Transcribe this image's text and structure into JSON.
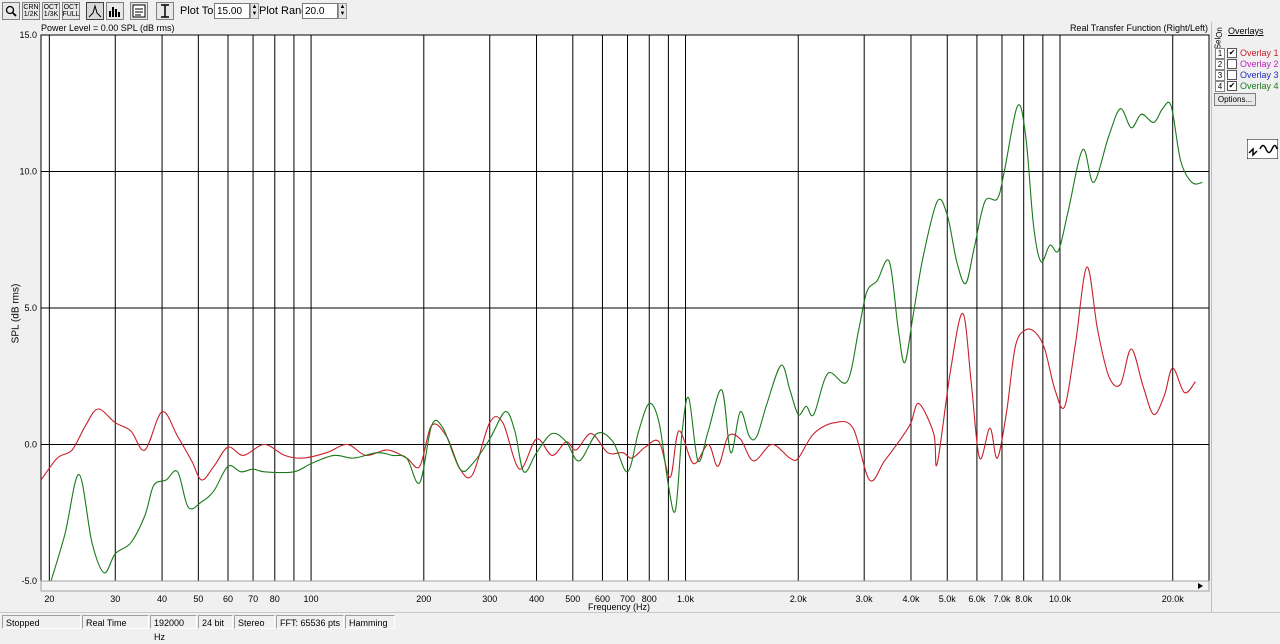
{
  "toolbar": {
    "buttons": [
      {
        "icon": "magnifier-icon"
      },
      {
        "label": "CRN\n1/2K"
      },
      {
        "label": "OCT\n1/3K"
      },
      {
        "label": "OCT\nFULL"
      },
      {
        "icon": "peak-icon"
      },
      {
        "icon": "bars-icon"
      },
      {
        "icon": "window-icon"
      },
      {
        "icon": "cursor-icon"
      }
    ],
    "plot_top_label": "Plot Top:",
    "plot_top_value": "15.00",
    "plot_range_label": "Plot Range:",
    "plot_range_value": "20.0"
  },
  "plot": {
    "power_level": "Power Level = 0.00 SPL (dB rms)",
    "mode": "Real Transfer Function (Right/Left)",
    "ylabel": "SPL (dB rms)",
    "xlabel": "Frequency (Hz)"
  },
  "overlays": {
    "title": "Overlays",
    "col_sel": "Sel",
    "col_on": "On",
    "options_label": "Options...",
    "items": [
      {
        "num": "1",
        "name": "Overlay 1",
        "checked": true,
        "color": "#c8202a"
      },
      {
        "num": "2",
        "name": "Overlay 2",
        "checked": false,
        "color": "#c020c0"
      },
      {
        "num": "3",
        "name": "Overlay 3",
        "checked": false,
        "color": "#2030c0"
      },
      {
        "num": "4",
        "name": "Overlay 4",
        "checked": true,
        "color": "#1a7a1a"
      }
    ]
  },
  "status": {
    "state": "Stopped",
    "mode": "Real Time",
    "rate": "192000 Hz",
    "bits": "24 bit",
    "channels": "Stereo",
    "fft": "FFT: 65536 pts",
    "window": "Hamming"
  },
  "chart_data": {
    "type": "line",
    "xscale": "log",
    "xlim": [
      19,
      25000
    ],
    "ylim": [
      -5,
      15
    ],
    "grid": true,
    "ylabel": "SPL (dB rms)",
    "xlabel": "Frequency (Hz)",
    "yticks": [
      "-5.0",
      "0.0",
      "5.0",
      "10.0",
      "15.0"
    ],
    "xticks": [
      {
        "v": 20,
        "l": "20"
      },
      {
        "v": 30,
        "l": "30"
      },
      {
        "v": 40,
        "l": "40"
      },
      {
        "v": 50,
        "l": "50"
      },
      {
        "v": 60,
        "l": "60"
      },
      {
        "v": 70,
        "l": "70"
      },
      {
        "v": 80,
        "l": "80"
      },
      {
        "v": 90,
        "l": ""
      },
      {
        "v": 100,
        "l": "100"
      },
      {
        "v": 200,
        "l": "200"
      },
      {
        "v": 300,
        "l": "300"
      },
      {
        "v": 400,
        "l": "400"
      },
      {
        "v": 500,
        "l": "500"
      },
      {
        "v": 600,
        "l": "600"
      },
      {
        "v": 700,
        "l": "700"
      },
      {
        "v": 800,
        "l": "800"
      },
      {
        "v": 900,
        "l": ""
      },
      {
        "v": 1000,
        "l": "1.0k"
      },
      {
        "v": 2000,
        "l": "2.0k"
      },
      {
        "v": 3000,
        "l": "3.0k"
      },
      {
        "v": 4000,
        "l": "4.0k"
      },
      {
        "v": 5000,
        "l": "5.0k"
      },
      {
        "v": 6000,
        "l": "6.0k"
      },
      {
        "v": 7000,
        "l": "7.0k"
      },
      {
        "v": 8000,
        "l": "8.0k"
      },
      {
        "v": 9000,
        "l": ""
      },
      {
        "v": 10000,
        "l": "10.0k"
      },
      {
        "v": 20000,
        "l": "20.0k"
      }
    ],
    "series": [
      {
        "name": "Overlay 1",
        "color": "#c8202a",
        "points": [
          [
            19,
            -1.3
          ],
          [
            21,
            -0.5
          ],
          [
            23,
            -0.2
          ],
          [
            25,
            0.7
          ],
          [
            27,
            1.3
          ],
          [
            30,
            0.8
          ],
          [
            33,
            0.5
          ],
          [
            36,
            -0.2
          ],
          [
            40,
            1.2
          ],
          [
            44,
            0.3
          ],
          [
            48,
            -0.6
          ],
          [
            51,
            -1.3
          ],
          [
            55,
            -0.8
          ],
          [
            60,
            -0.1
          ],
          [
            66,
            -0.4
          ],
          [
            75,
            0
          ],
          [
            85,
            -0.4
          ],
          [
            95,
            -0.5
          ],
          [
            110,
            -0.3
          ],
          [
            125,
            0
          ],
          [
            140,
            -0.4
          ],
          [
            160,
            -0.2
          ],
          [
            180,
            -0.5
          ],
          [
            195,
            -0.8
          ],
          [
            210,
            0.7
          ],
          [
            230,
            0.3
          ],
          [
            250,
            -0.9
          ],
          [
            270,
            -1.1
          ],
          [
            300,
            0.8
          ],
          [
            325,
            0.8
          ],
          [
            360,
            -0.9
          ],
          [
            400,
            0.2
          ],
          [
            440,
            -0.4
          ],
          [
            480,
            0.1
          ],
          [
            510,
            -0.2
          ],
          [
            560,
            0.4
          ],
          [
            620,
            -0.3
          ],
          [
            680,
            -0.3
          ],
          [
            720,
            -0.5
          ],
          [
            780,
            -0.1
          ],
          [
            850,
            0.1
          ],
          [
            910,
            -1.2
          ],
          [
            960,
            0.5
          ],
          [
            1050,
            -0.7
          ],
          [
            1150,
            0
          ],
          [
            1220,
            -0.8
          ],
          [
            1300,
            0.3
          ],
          [
            1400,
            0.2
          ],
          [
            1520,
            -0.6
          ],
          [
            1700,
            0
          ],
          [
            1900,
            -0.5
          ],
          [
            2000,
            -0.5
          ],
          [
            2200,
            0.4
          ],
          [
            2500,
            0.8
          ],
          [
            2800,
            0.6
          ],
          [
            3100,
            -1.3
          ],
          [
            3400,
            -0.6
          ],
          [
            3800,
            0.3
          ],
          [
            4000,
            0.8
          ],
          [
            4200,
            1.5
          ],
          [
            4600,
            0.4
          ],
          [
            4700,
            -0.7
          ],
          [
            5100,
            2.7
          ],
          [
            5500,
            4.8
          ],
          [
            5800,
            2.2
          ],
          [
            6100,
            -0.5
          ],
          [
            6500,
            0.6
          ],
          [
            6800,
            -0.5
          ],
          [
            7200,
            1.2
          ],
          [
            7600,
            3.6
          ],
          [
            8100,
            4.2
          ],
          [
            8600,
            4.1
          ],
          [
            9100,
            3.5
          ],
          [
            9700,
            2.0
          ],
          [
            10300,
            1.4
          ],
          [
            11000,
            3.7
          ],
          [
            11800,
            6.5
          ],
          [
            12600,
            4.2
          ],
          [
            13500,
            2.5
          ],
          [
            14500,
            2.2
          ],
          [
            15500,
            3.5
          ],
          [
            16700,
            2.1
          ],
          [
            17800,
            1.1
          ],
          [
            19000,
            1.8
          ],
          [
            20000,
            2.8
          ],
          [
            21500,
            1.9
          ],
          [
            23000,
            2.3
          ]
        ]
      },
      {
        "name": "Overlay 4",
        "color": "#1a7a1a",
        "points": [
          [
            20,
            -5.2
          ],
          [
            22,
            -3.3
          ],
          [
            24,
            -1.1
          ],
          [
            26,
            -3.6
          ],
          [
            28,
            -4.7
          ],
          [
            30,
            -4.0
          ],
          [
            33,
            -3.6
          ],
          [
            36,
            -2.6
          ],
          [
            38,
            -1.5
          ],
          [
            41,
            -1.3
          ],
          [
            44,
            -1.0
          ],
          [
            47,
            -2.3
          ],
          [
            51,
            -2.1
          ],
          [
            55,
            -1.7
          ],
          [
            60,
            -0.8
          ],
          [
            65,
            -1.0
          ],
          [
            70,
            -0.9
          ],
          [
            75,
            -1.0
          ],
          [
            90,
            -1.0
          ],
          [
            100,
            -0.7
          ],
          [
            115,
            -0.4
          ],
          [
            130,
            -0.5
          ],
          [
            150,
            -0.3
          ],
          [
            165,
            -0.4
          ],
          [
            180,
            -0.5
          ],
          [
            195,
            -1.4
          ],
          [
            210,
            0.7
          ],
          [
            225,
            0.6
          ],
          [
            250,
            -0.9
          ],
          [
            270,
            -0.7
          ],
          [
            300,
            0.2
          ],
          [
            330,
            1.2
          ],
          [
            350,
            0.5
          ],
          [
            370,
            -1.0
          ],
          [
            400,
            -0.3
          ],
          [
            440,
            0.4
          ],
          [
            480,
            0.1
          ],
          [
            520,
            -0.6
          ],
          [
            580,
            0.4
          ],
          [
            640,
            0.1
          ],
          [
            700,
            -1.0
          ],
          [
            750,
            0.5
          ],
          [
            800,
            1.5
          ],
          [
            850,
            0.8
          ],
          [
            900,
            -1.5
          ],
          [
            940,
            -2.4
          ],
          [
            980,
            0.5
          ],
          [
            1020,
            1.7
          ],
          [
            1080,
            -0.6
          ],
          [
            1150,
            0.5
          ],
          [
            1250,
            2.0
          ],
          [
            1320,
            -0.3
          ],
          [
            1400,
            1.2
          ],
          [
            1480,
            0.3
          ],
          [
            1550,
            0.3
          ],
          [
            1650,
            1.5
          ],
          [
            1800,
            2.9
          ],
          [
            1900,
            2.0
          ],
          [
            2000,
            1.1
          ],
          [
            2100,
            1.4
          ],
          [
            2200,
            1.1
          ],
          [
            2400,
            2.6
          ],
          [
            2700,
            2.3
          ],
          [
            2900,
            4.2
          ],
          [
            3050,
            5.6
          ],
          [
            3250,
            6.0
          ],
          [
            3500,
            6.7
          ],
          [
            3700,
            4.2
          ],
          [
            3850,
            3.0
          ],
          [
            4050,
            4.7
          ],
          [
            4300,
            6.8
          ],
          [
            4700,
            8.9
          ],
          [
            5000,
            8.4
          ],
          [
            5300,
            6.7
          ],
          [
            5600,
            5.9
          ],
          [
            5900,
            7.2
          ],
          [
            6300,
            8.9
          ],
          [
            6800,
            9.0
          ],
          [
            7100,
            10.0
          ],
          [
            7700,
            12.4
          ],
          [
            8100,
            11.3
          ],
          [
            8500,
            8.0
          ],
          [
            8900,
            6.7
          ],
          [
            9400,
            7.3
          ],
          [
            9900,
            7.1
          ],
          [
            10500,
            8.5
          ],
          [
            11500,
            10.8
          ],
          [
            12300,
            9.6
          ],
          [
            13500,
            11.3
          ],
          [
            14500,
            12.3
          ],
          [
            15500,
            11.6
          ],
          [
            16500,
            12.1
          ],
          [
            17800,
            11.8
          ],
          [
            18800,
            12.3
          ],
          [
            19800,
            12.4
          ],
          [
            21000,
            10.4
          ],
          [
            22500,
            9.6
          ],
          [
            24000,
            9.6
          ]
        ]
      }
    ]
  }
}
